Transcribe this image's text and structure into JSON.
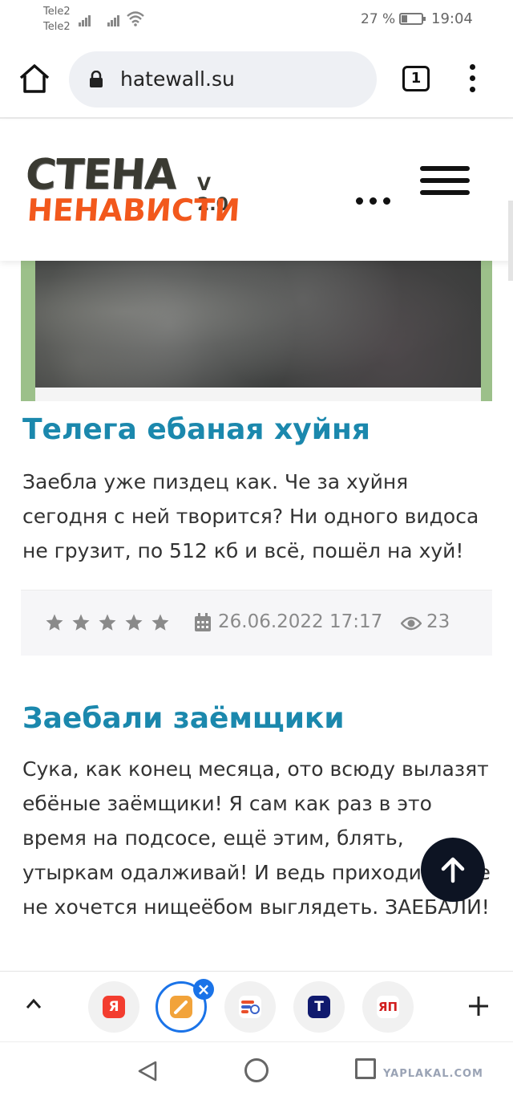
{
  "status_bar": {
    "carrier_1": "Tele2",
    "carrier_2": "Tele2",
    "battery_percent": "27 %",
    "battery_level": 0.27,
    "time": "19:04"
  },
  "browser": {
    "url": "hatewall.su",
    "tab_count": "1",
    "icons": [
      "home-icon",
      "lock-icon",
      "tabs-icon",
      "more-vert-icon"
    ]
  },
  "site_header": {
    "logo_line_1": "СТЕНА",
    "logo_version": "V 2.0",
    "logo_line_2": "НЕНАВИСТИ",
    "logo_colors": {
      "line_1": "#3a3a32",
      "line_2": "#f2581c"
    },
    "icons": [
      "more-horiz-icon",
      "hamburger-icon"
    ]
  },
  "posts": [
    {
      "title": "Телега ебаная хуйня",
      "body": "Заебла уже пиздец как. Че за хуйня сегодня с ней творится? Ни одного видоса не грузит, по 512 кб и всё, пошёл на хуй!",
      "rating_stars": 5,
      "date": "26.06.2022 17:17",
      "views": "23"
    },
    {
      "title": "Заебали заёмщики",
      "body": "Сука, как конец месяца, ото всюду вылазят ебёные заёмщики! Я сам как раз в это время на подсосе, ещё этим, блять, утыркам одалживай! И ведь приходи иначе не хочется нищеёбом выглядеть. ЗАЕБАЛИ!"
    }
  ],
  "accent_color": "#1b88ad",
  "tab_bar": {
    "tabs": [
      {
        "icon": "yandex-icon",
        "label": "Я",
        "color": "#f33d2f"
      },
      {
        "icon": "brush-app-icon",
        "color": "#f2a33a",
        "active": true
      },
      {
        "icon": "news-app-icon",
        "color": "#e94f2b"
      },
      {
        "icon": "t-app-icon",
        "label": "T",
        "color": "#101a6e"
      },
      {
        "icon": "yap-app-icon",
        "label": "ЯП",
        "color": "#d11e1e"
      }
    ]
  },
  "watermark": "YAPLAKAL.COM"
}
